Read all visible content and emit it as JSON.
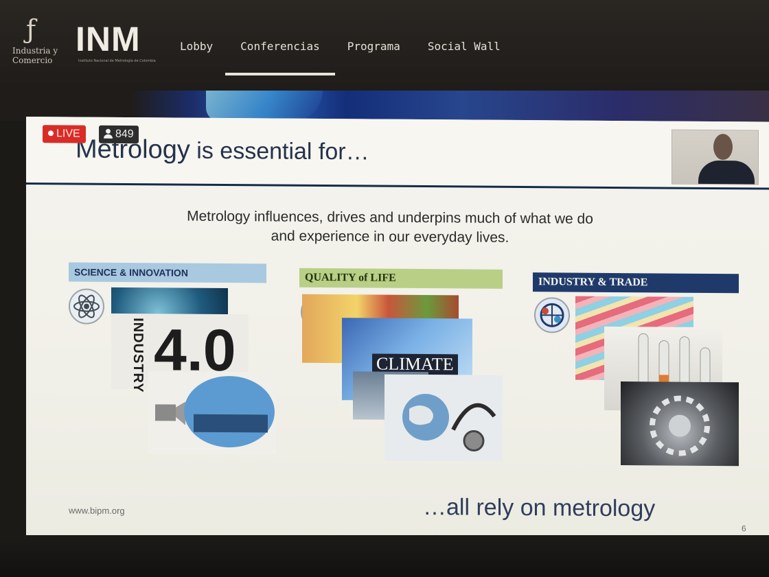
{
  "brand": {
    "logo_line1": "Industria y",
    "logo_line2": "Comercio",
    "logo_wordmark": "INM",
    "logo_small": "Instituto Nacional de Metrología de Colombia"
  },
  "nav": {
    "items": [
      {
        "label": "Lobby"
      },
      {
        "label": "Conferencias",
        "active": true
      },
      {
        "label": "Programa"
      },
      {
        "label": "Social Wall"
      }
    ]
  },
  "stream": {
    "live_label": "LIVE",
    "viewers": "849"
  },
  "slide": {
    "title_first": "Metrology",
    "title_rest": " is essential for…",
    "intro": "Metrology influences, drives and underpins much of what we do and experience in our everyday lives.",
    "columns": [
      {
        "title": "SCIENCE & INNOVATION"
      },
      {
        "title": "QUALITY of LIFE"
      },
      {
        "title": "INDUSTRY & TRADE"
      }
    ],
    "industry_text": "INDUSTRY",
    "industry_number": "4.0",
    "climate_label": "CLIMATE",
    "footer_url": "www.bipm.org",
    "tagline": "…all rely on metrology",
    "page_number": "6"
  },
  "colors": {
    "live": "#d92c26",
    "title": "#25324a",
    "science_header": "#a8c9e0",
    "quality_header": "#b9cf86",
    "industry_header": "#1f3a6a"
  }
}
